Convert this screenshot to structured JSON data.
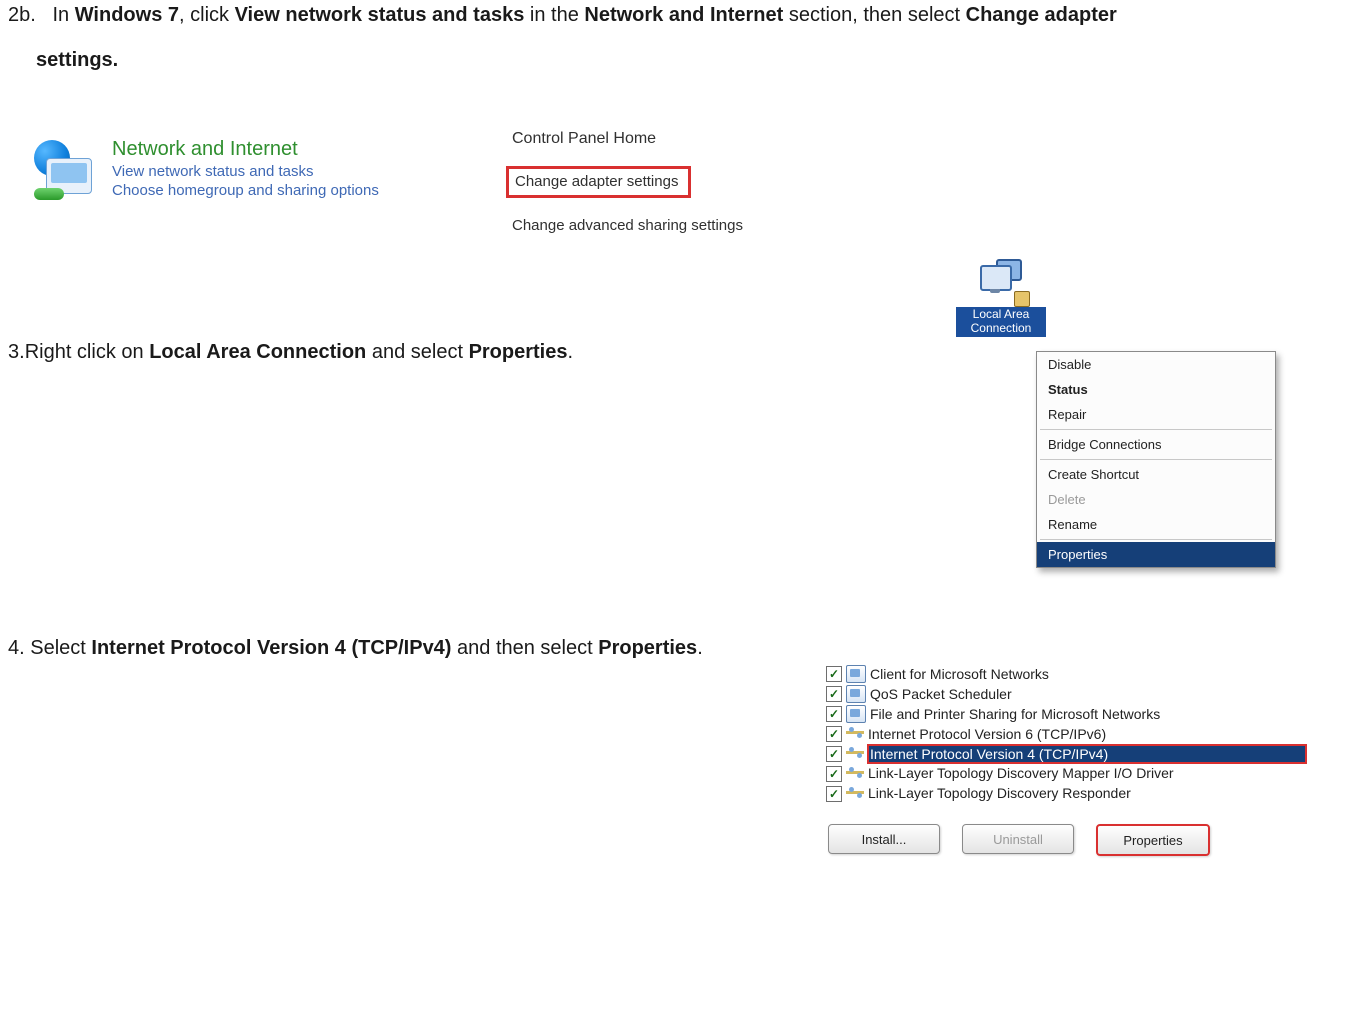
{
  "step2b": {
    "number": "2b.",
    "prefix": "In ",
    "bold1": "Windows 7",
    "mid1": ", click ",
    "bold2": "View network status and tasks",
    "mid2": " in the ",
    "bold3": "Network and Internet",
    "mid3": " section, then select ",
    "bold4": "Change adapter",
    "line2_bold": "settings."
  },
  "panelA": {
    "heading": "Network and Internet",
    "link1": "View network status and tasks",
    "link2": "Choose homegroup and sharing options"
  },
  "panelB": {
    "heading": "Control Panel Home",
    "boxed_link": "Change adapter settings",
    "link2": "Change advanced sharing settings"
  },
  "step3": {
    "number": "3.",
    "prefix": "Right click on ",
    "bold1": "Local Area Connection",
    "mid1": " and select ",
    "bold2": "Properties",
    "suffix": "."
  },
  "lac_label_line1": "Local Area",
  "lac_label_line2": "Connection",
  "contextMenu": {
    "items": [
      {
        "label": "Disable",
        "bold": false,
        "disabled": false,
        "selected": false
      },
      {
        "label": "Status",
        "bold": true,
        "disabled": false,
        "selected": false
      },
      {
        "label": "Repair",
        "bold": false,
        "disabled": false,
        "selected": false
      },
      {
        "sep": true
      },
      {
        "label": "Bridge Connections",
        "bold": false,
        "disabled": false,
        "selected": false
      },
      {
        "sep": true
      },
      {
        "label": "Create Shortcut",
        "bold": false,
        "disabled": false,
        "selected": false
      },
      {
        "label": "Delete",
        "bold": false,
        "disabled": true,
        "selected": false
      },
      {
        "label": "Rename",
        "bold": false,
        "disabled": false,
        "selected": false
      },
      {
        "sep": true
      },
      {
        "label": "Properties",
        "bold": false,
        "disabled": false,
        "selected": true
      }
    ]
  },
  "step4": {
    "number": "4.",
    "prefix": " Select ",
    "bold1": "Internet Protocol Version 4 (TCP/IPv4)",
    "mid1": " and then select ",
    "bold2": "Properties",
    "suffix": "."
  },
  "itemsList": [
    {
      "checked": true,
      "iconClass": "svc",
      "label": "Client for Microsoft Networks",
      "selected": false
    },
    {
      "checked": true,
      "iconClass": "svc",
      "label": "QoS Packet Scheduler",
      "selected": false
    },
    {
      "checked": true,
      "iconClass": "svc",
      "label": "File and Printer Sharing for Microsoft Networks",
      "selected": false
    },
    {
      "checked": true,
      "iconClass": "proto",
      "label": "Internet Protocol Version 6 (TCP/IPv6)",
      "selected": false
    },
    {
      "checked": true,
      "iconClass": "proto",
      "label": "Internet Protocol Version 4 (TCP/IPv4)",
      "selected": true
    },
    {
      "checked": true,
      "iconClass": "proto",
      "label": "Link-Layer Topology Discovery Mapper I/O Driver",
      "selected": false
    },
    {
      "checked": true,
      "iconClass": "proto",
      "label": "Link-Layer Topology Discovery Responder",
      "selected": false
    }
  ],
  "buttons": {
    "install": "Install...",
    "uninstall": "Uninstall",
    "properties": "Properties"
  },
  "checkmark_glyph": "✓"
}
